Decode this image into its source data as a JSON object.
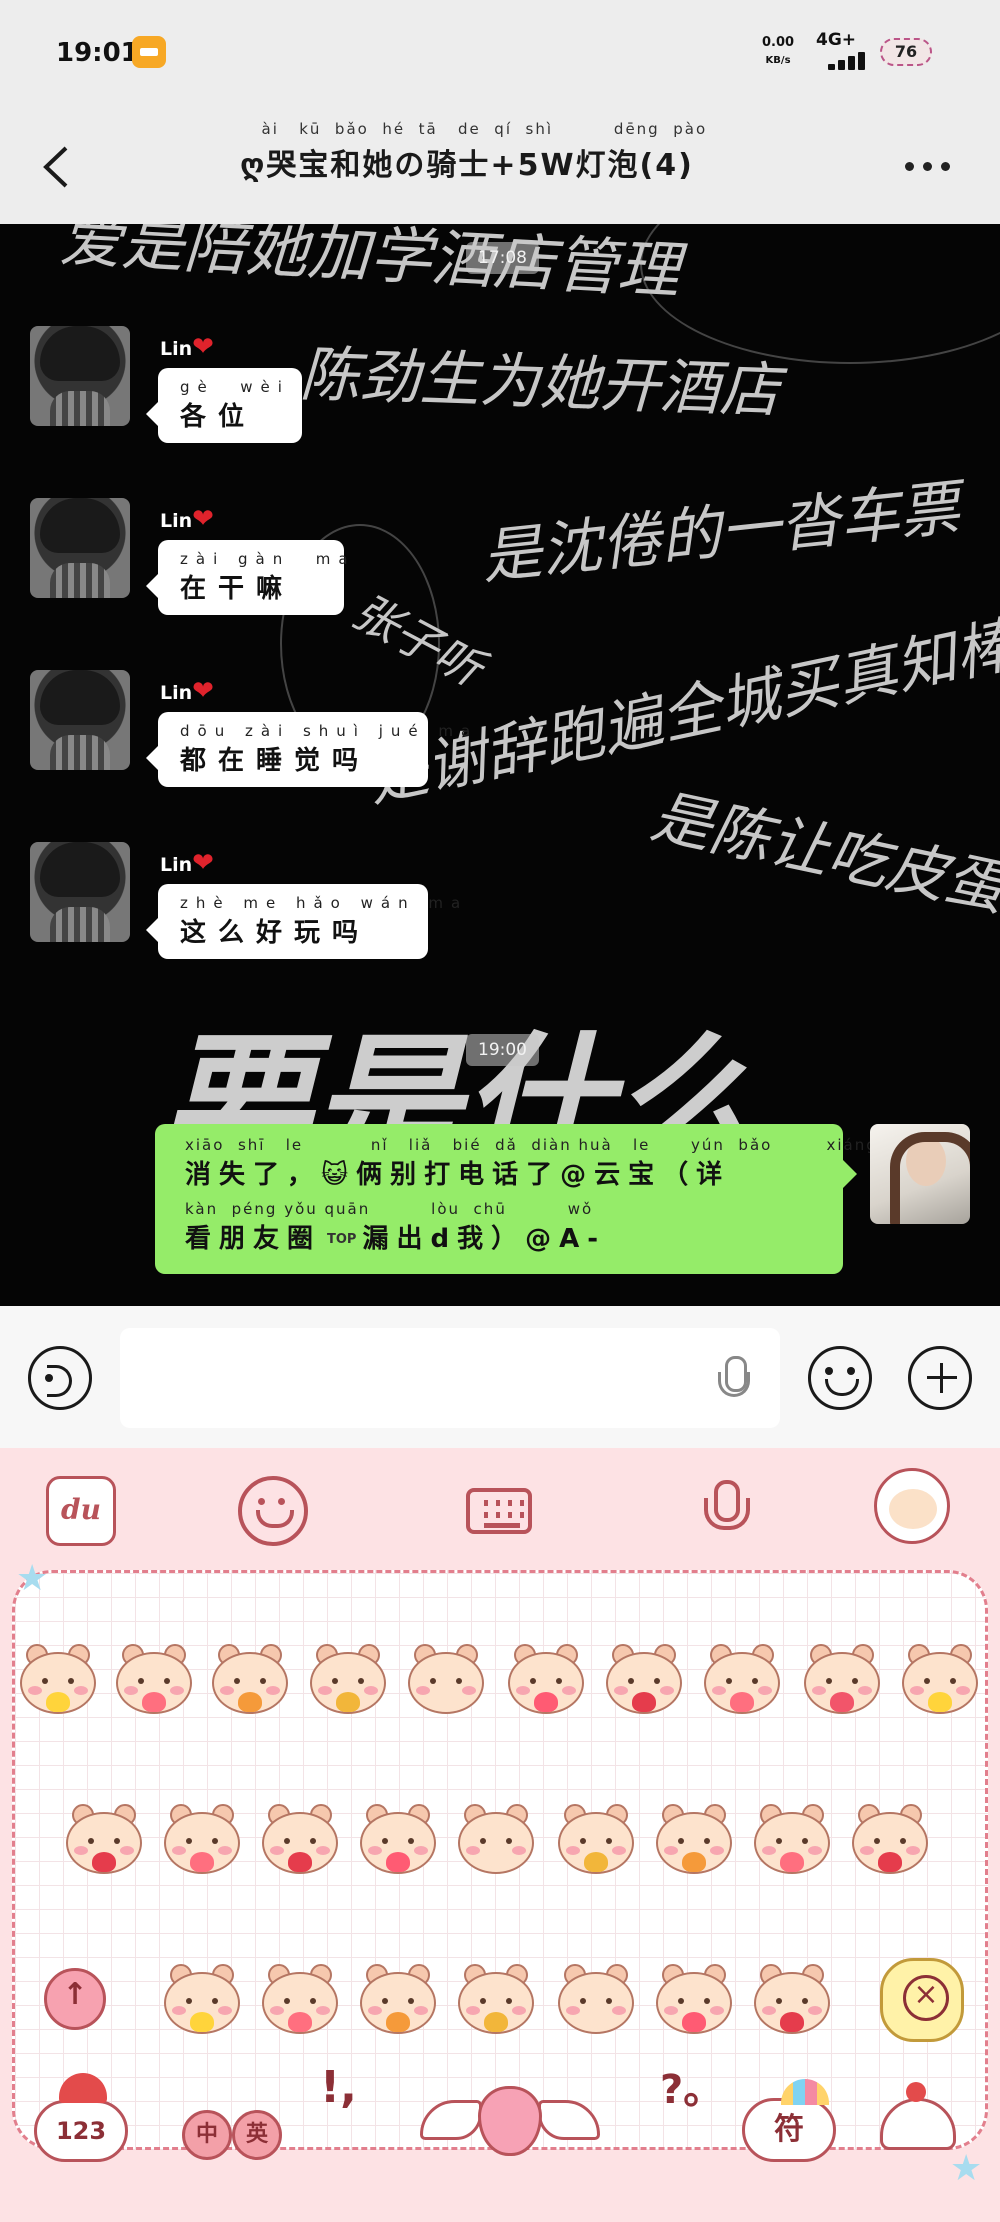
{
  "status_bar": {
    "time": "19:01",
    "speed_value": "0.00",
    "speed_unit": "KB/s",
    "network": "4G+",
    "battery": "76"
  },
  "nav": {
    "title": "ღ哭宝和她の骑士+5W灯泡(4)",
    "title_pinyin": "  ài   kū  bǎo  hé  tā   de  qí  shì         dēng  pào"
  },
  "chat": {
    "timestamps": [
      "17:08",
      "19:00"
    ],
    "background_text": [
      "爱是陪她加学酒店管理",
      "陈劲生为她开酒店",
      "是沈倦的一沓车票",
      "是谢辞跑遍全城买真知棒",
      "是陈让吃皮蛋",
      "张子听",
      "要是什么"
    ],
    "messages": [
      {
        "sender": "Lin",
        "pinyin": "gè  wèi",
        "text": "各位"
      },
      {
        "sender": "Lin",
        "pinyin": "zài gàn  ma",
        "text": "在干嘛"
      },
      {
        "sender": "Lin",
        "pinyin": "dōu zài shuì jué ma",
        "text": "都在睡觉吗"
      },
      {
        "sender": "Lin",
        "pinyin": "zhè me hǎo wán ma",
        "text": "这么好玩吗"
      }
    ],
    "my_message": {
      "line1_pinyin": "xiāo  shī   le          nǐ   liǎ   bié  dǎ  diàn huà   le      yún  bǎo        xiáng",
      "line1_text": "消失了，😺俩别打电话了@云宝（详",
      "line2_pinyin": "kàn  péng yǒu quān         lòu  chū         wǒ",
      "line2_text": "看朋友圈",
      "line2_badge": "TOP",
      "line2_text_b": "漏出d我）@A-"
    }
  },
  "input": {
    "placeholder": ""
  },
  "keyboard": {
    "du_label": "du",
    "key_123": "123",
    "key_zh": "中",
    "key_en": "英",
    "key_punct": "!,",
    "key_question": "?。",
    "key_fu": "符"
  },
  "colors": {
    "my_bubble": "#95ec69",
    "keyboard_bg": "#fde2e4",
    "accent": "#b8535a"
  }
}
